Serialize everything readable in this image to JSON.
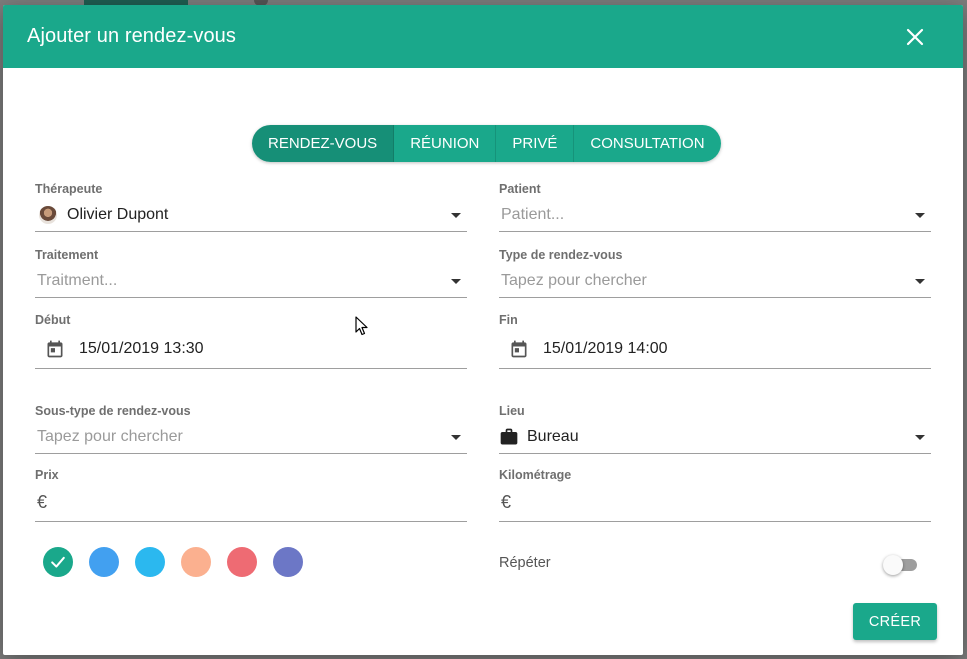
{
  "dialog": {
    "title": "Ajouter un rendez-vous",
    "close_icon": "close-icon"
  },
  "types": [
    {
      "label": "RENDEZ-VOUS",
      "active": true
    },
    {
      "label": "RÉUNION",
      "active": false
    },
    {
      "label": "PRIVÉ",
      "active": false
    },
    {
      "label": "CONSULTATION",
      "active": false
    }
  ],
  "fields": {
    "therapist": {
      "label": "Thérapeute",
      "value": "Olivier Dupont"
    },
    "patient": {
      "label": "Patient",
      "placeholder": "Patient..."
    },
    "treatment": {
      "label": "Traitement",
      "placeholder": "Traitment..."
    },
    "appointment_type": {
      "label": "Type de rendez-vous",
      "placeholder": "Tapez pour chercher"
    },
    "start": {
      "label": "Début",
      "value": "15/01/2019 13:30",
      "icon": "calendar-icon"
    },
    "end": {
      "label": "Fin",
      "value": "15/01/2019 14:00",
      "icon": "calendar-icon"
    },
    "subtype": {
      "label": "Sous-type de rendez-vous",
      "placeholder": "Tapez pour chercher"
    },
    "location": {
      "label": "Lieu",
      "value": "Bureau",
      "icon": "briefcase-icon"
    },
    "price": {
      "label": "Prix",
      "symbol": "€"
    },
    "mileage": {
      "label": "Kilométrage",
      "symbol": "€"
    }
  },
  "colors": [
    {
      "hex": "#1aa88b",
      "selected": true
    },
    {
      "hex": "#42a0f0",
      "selected": false
    },
    {
      "hex": "#2bb8ef",
      "selected": false
    },
    {
      "hex": "#fbb08f",
      "selected": false
    },
    {
      "hex": "#ee6b73",
      "selected": false
    },
    {
      "hex": "#6c77c6",
      "selected": false
    }
  ],
  "repeat": {
    "label": "Répéter",
    "enabled": false
  },
  "actions": {
    "create_label": "CRÉER"
  },
  "theme": {
    "accent": "#1aa88b"
  }
}
